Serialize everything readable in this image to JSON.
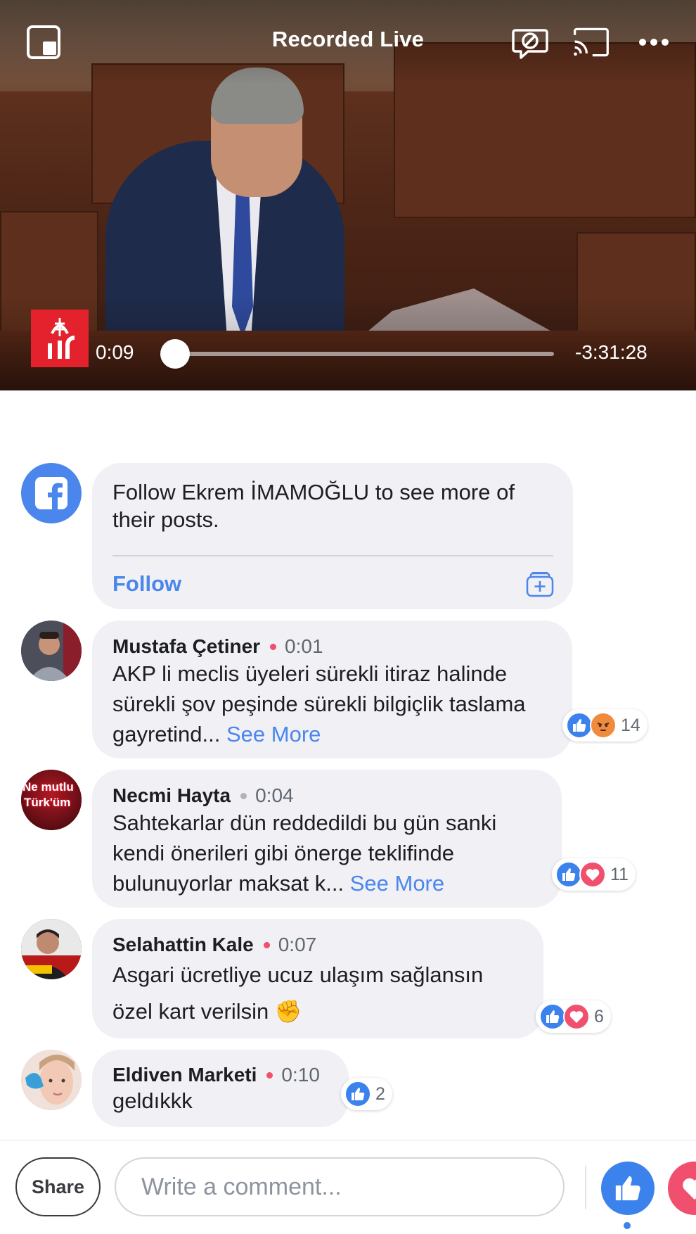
{
  "video": {
    "title": "Recorded Live",
    "elapsed": "0:09",
    "remaining": "-3:31:28",
    "progress_fraction": 0.001,
    "top_icons": [
      "picture-in-picture-icon",
      "comments-off-icon",
      "cast-icon",
      "more-icon"
    ]
  },
  "follow_card": {
    "text": "Follow Ekrem İMAMOĞLU to see more of their posts.",
    "action": "Follow"
  },
  "comments": [
    {
      "author": "Mustafa Çetiner",
      "time": "0:01",
      "text": "AKP li meclis üyeleri sürekli itiraz halinde sürekli şov peşinde sürekli bilgiçlik taslama gayretind...",
      "see_more": "See More",
      "reactions": [
        "like",
        "angry"
      ],
      "reaction_count": "14",
      "dot_color": "#f0506e"
    },
    {
      "author": "Necmi Hayta",
      "time": "0:04",
      "text": "Sahtekarlar dün reddedildi bu gün sanki kendi önerileri gibi önerge teklifinde bulunuyorlar maksat k...",
      "see_more": "See More",
      "reactions": [
        "like",
        "love"
      ],
      "reaction_count": "11",
      "dot_color": "#b0b3b8",
      "avatar_text_1": "Ne mutlu",
      "avatar_text_2": "Türk'üm"
    },
    {
      "author": "Selahattin Kale",
      "time": "0:07",
      "text": "Asgari ücretliye ucuz ulaşım sağlansın özel kart verilsin",
      "emoji": "✊",
      "reactions": [
        "like",
        "love"
      ],
      "reaction_count": "6",
      "dot_color": "#f0506e"
    },
    {
      "author": "Eldiven Marketi",
      "time": "0:10",
      "text": "geldıkkk",
      "reactions": [
        "like"
      ],
      "reaction_count": "2",
      "dot_color": "#f0506e"
    }
  ],
  "bottom_bar": {
    "share_label": "Share",
    "comment_placeholder": "Write a comment..."
  },
  "colors": {
    "accent": "#4a86ec",
    "like": "#3b82ec",
    "love": "#f0506e",
    "angry": "#f08a3c",
    "bubble": "#f0f0f5"
  }
}
